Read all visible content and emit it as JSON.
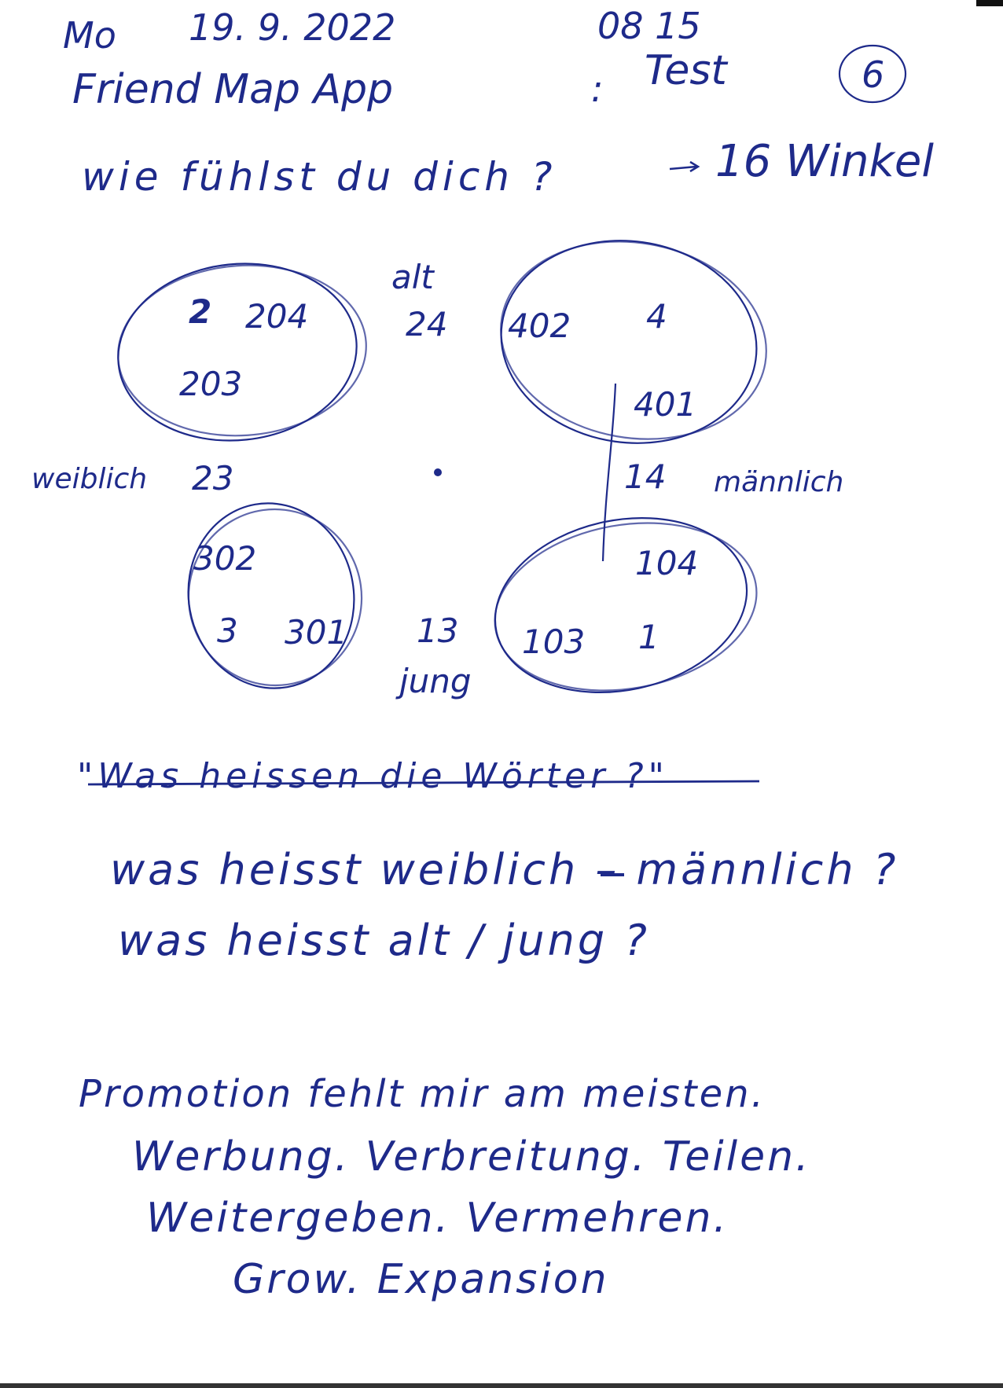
{
  "header": {
    "day": "Mo",
    "date": "19. 9. 2022",
    "time": "08 15",
    "app_name": "Friend Map App",
    "separator": ":",
    "test_label": "Test",
    "page_number": "6"
  },
  "question": {
    "text": "wie fühlst du dich ?",
    "arrow": "→",
    "answer": "16 Winkel"
  },
  "map": {
    "axis_top": "alt",
    "axis_bottom": "jung",
    "axis_left": "weiblich",
    "axis_right": "männlich",
    "center_top_value": "24",
    "center_left_value": "23",
    "center_right_value": "14",
    "center_bottom_value": "13",
    "quadrant_top_left": {
      "mark": "2",
      "a": "204",
      "b": "203"
    },
    "quadrant_top_right": {
      "a": "402",
      "mark": "4",
      "b": "401"
    },
    "quadrant_bottom_left": {
      "a": "302",
      "mark": "3",
      "b": "301"
    },
    "quadrant_bottom_right": {
      "a": "104",
      "b": "103",
      "mark": "1"
    }
  },
  "questions": {
    "struck": "\"Was heissen die Wörter ?\"",
    "line1": "was heisst weiblich – männlich ?",
    "line2": "was heisst alt / jung ?"
  },
  "notes": {
    "line1": "Promotion fehlt mir am meisten.",
    "line2": "Werbung. Verbreitung. Teilen.",
    "line3": "Weitergeben. Vermehren.",
    "line4": "Grow. Expansion"
  }
}
